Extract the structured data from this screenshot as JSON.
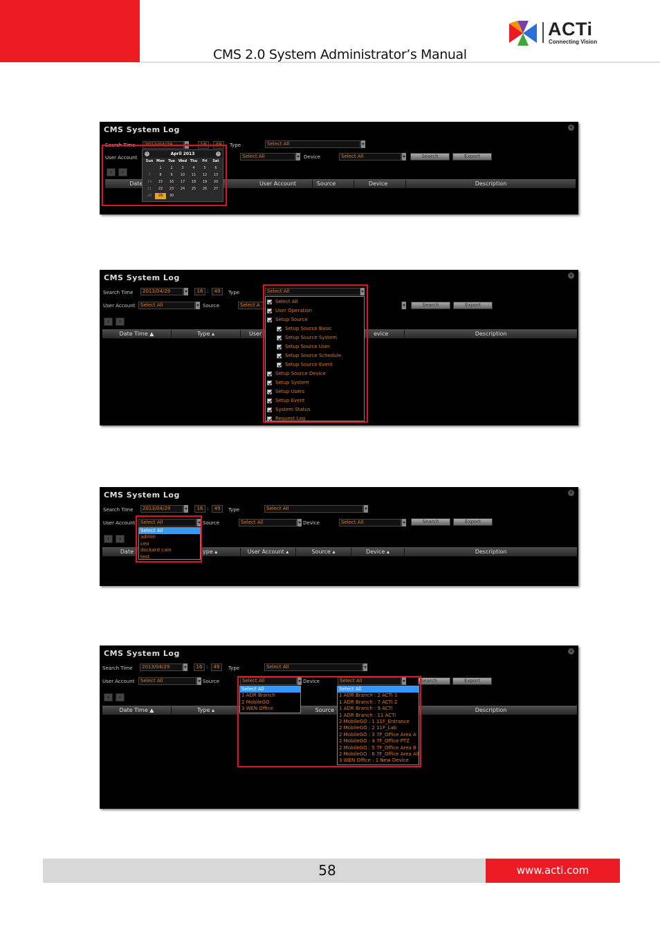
{
  "header": {
    "title": "CMS 2.0 System Administrator’s Manual",
    "logo_word": "ACTi",
    "logo_tagline": "Connecting Vision"
  },
  "footer": {
    "page_number": "58",
    "url": "www.acti.com"
  },
  "colors": {
    "brand_red": "#ed1c24",
    "highlight_red": "#e5121d",
    "field_orange": "#e07a20",
    "select_blue": "#3399ff"
  },
  "panel_title": "CMS System Log",
  "labels": {
    "search_time": "Search Time",
    "user_account": "User Account",
    "type": "Type",
    "source": "Source",
    "device": "Device",
    "search": "Search",
    "export": "Export",
    "date": "2013/04/29",
    "hour": "16",
    "minute": "49",
    "select_all": "Select All",
    "colon": ":"
  },
  "columns": {
    "date_time": "Date Time",
    "type": "Type",
    "user_account": "User Account",
    "source": "Source",
    "device": "Device",
    "description": "Description"
  },
  "panel1": {
    "date_partial": "2013/04/29",
    "source_partial": "Select All",
    "date_time_partial": "Date Ti"
  },
  "calendar": {
    "month": "April 2013",
    "days": [
      "Sun",
      "Mon",
      "Tue",
      "Wed",
      "Thu",
      "Fri",
      "Sat"
    ],
    "selected_day": "29",
    "weeks": [
      [
        "",
        "1",
        "2",
        "3",
        "4",
        "5",
        "6"
      ],
      [
        "7",
        "8",
        "9",
        "10",
        "11",
        "12",
        "13"
      ],
      [
        "14",
        "15",
        "16",
        "17",
        "18",
        "19",
        "20"
      ],
      [
        "21",
        "22",
        "23",
        "24",
        "25",
        "26",
        "27"
      ],
      [
        "28",
        "29",
        "30",
        "",
        "",
        "",
        ""
      ]
    ]
  },
  "panel2": {
    "source_partial": "Select A",
    "user_partial": "User",
    "device_partial": "evice",
    "type_options": [
      {
        "label": "Select All",
        "indent": false
      },
      {
        "label": "User Operation",
        "indent": false
      },
      {
        "label": "Setup Source",
        "indent": false
      },
      {
        "label": "Setup Source Basic",
        "indent": true
      },
      {
        "label": "Setup Source System",
        "indent": true
      },
      {
        "label": "Setup Source User",
        "indent": true
      },
      {
        "label": "Setup Source Schedule",
        "indent": true
      },
      {
        "label": "Setup Source Event",
        "indent": true
      },
      {
        "label": "Setup Source Device",
        "indent": false
      },
      {
        "label": "Setup System",
        "indent": false
      },
      {
        "label": "Setup Users",
        "indent": false
      },
      {
        "label": "Setup Event",
        "indent": false
      },
      {
        "label": "System Status",
        "indent": false
      },
      {
        "label": "Request Log",
        "indent": false
      }
    ]
  },
  "panel3": {
    "date_partial": "Date",
    "type_partial": "ype",
    "user_options": [
      "Select All",
      "admin",
      "ceo",
      "dockard cain",
      "test"
    ]
  },
  "panel4": {
    "source_options": [
      "Select All",
      "1 ADR Branch",
      "2 MobileGO",
      "3 WEN Office"
    ],
    "device_options": [
      "Select All",
      "1 ADR Branch : 2 ACTi 1",
      "1 ADR Branch : 7 ACTi 2",
      "1 ADR Branch : 9 ACTi",
      "1 ADR Branch : 11 ACTi",
      "2 MobileGO : 1 11F_Entrance",
      "2 MobileGO : 2 11F_Lab",
      "2 MobileGO : 3 7F_Office Area A",
      "2 MobileGO : 4 7F_Office PTZ",
      "2 MobileGO : 5 7F_Office Area B",
      "2 MobileGO : 6 7F_Office Area All",
      "3 WEN Office : 1 New Device"
    ],
    "search_partial": "Search",
    "source_col_partial": "Source"
  }
}
